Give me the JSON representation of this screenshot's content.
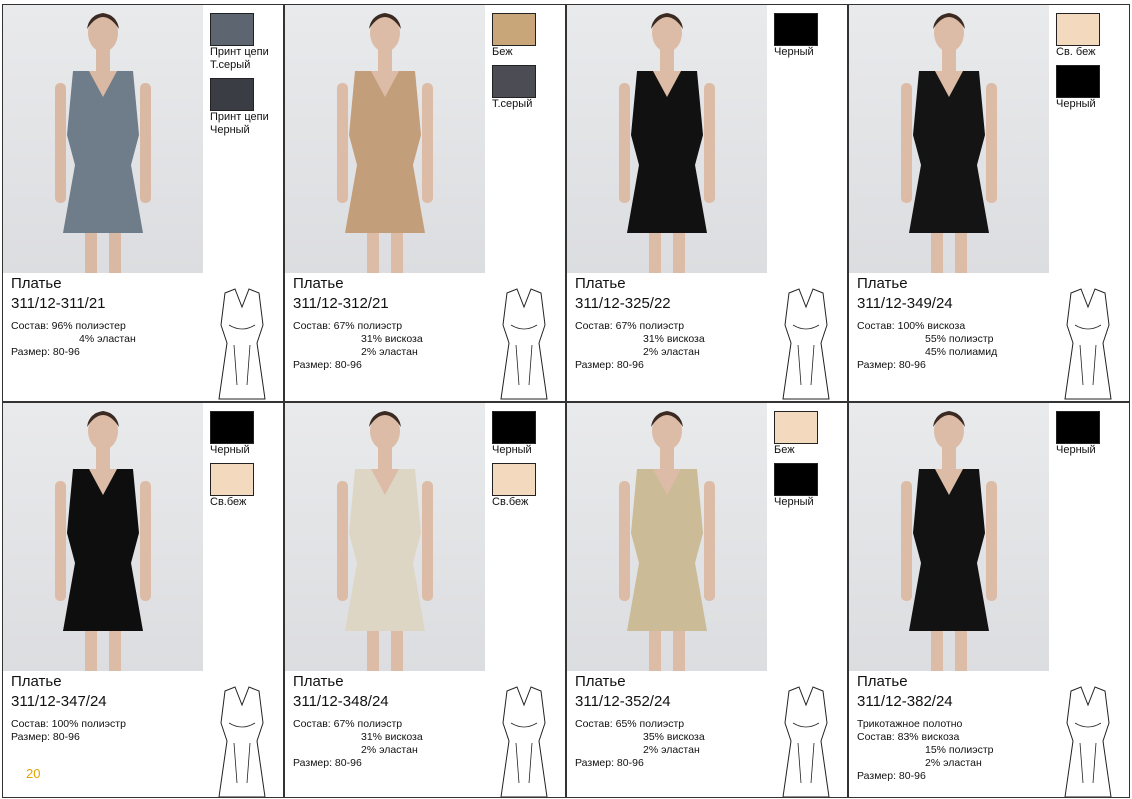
{
  "page_number": "20",
  "cards": [
    {
      "title": "Платье",
      "code": "311/12-311/21",
      "composition": [
        "Состав: 96% полиэстер",
        "4% эластан"
      ],
      "size": "Размер: 80-96",
      "swatches": [
        {
          "label": "Принт цепи\nТ.серый",
          "color": "#5d6670"
        },
        {
          "label": "Принт цепи\nЧерный",
          "color": "#3a3d44"
        }
      ],
      "dress_color": "#6f7c8a",
      "skin": "#d9b8a4"
    },
    {
      "title": "Платье",
      "code": "311/12-312/21",
      "composition": [
        "Состав: 67% полиэстр",
        "31% вискоза",
        "2% эластан"
      ],
      "size": "Размер: 80-96",
      "swatches": [
        {
          "label": "Беж",
          "color": "#c9a57a"
        },
        {
          "label": "Т.серый",
          "color": "#4c4c55"
        }
      ],
      "dress_color": "#c39e7a",
      "skin": "#dcbca6"
    },
    {
      "title": "Платье",
      "code": "311/12-325/22",
      "composition": [
        "Состав: 67% полиэстр",
        "31% вискоза",
        "2% эластан"
      ],
      "size": "Размер: 80-96",
      "swatches": [
        {
          "label": "Черный",
          "color": "#000000"
        }
      ],
      "dress_color": "#111111",
      "skin": "#dcbca6"
    },
    {
      "title": "Платье",
      "code": "311/12-349/24",
      "composition": [
        "Состав: 100% вискоза",
        "55% полиэстр",
        "45% полиамид"
      ],
      "size": "Размер: 80-96",
      "swatches": [
        {
          "label": "Св. беж",
          "color": "#f3d9bd"
        },
        {
          "label": "Черный",
          "color": "#000000"
        }
      ],
      "dress_color": "#141414",
      "skin": "#dcbca6"
    },
    {
      "title": "Платье",
      "code": "311/12-347/24",
      "composition": [
        "Состав: 100% полиэстр"
      ],
      "size": "Размер: 80-96",
      "swatches": [
        {
          "label": "Черный",
          "color": "#000000"
        },
        {
          "label": "Св.беж",
          "color": "#f3d9bd"
        }
      ],
      "dress_color": "#0e0e0e",
      "skin": "#dcbca6"
    },
    {
      "title": "Платье",
      "code": "311/12-348/24",
      "composition": [
        "Состав: 67% полиэстр",
        "31% вискоза",
        "2% эластан"
      ],
      "size": "Размер: 80-96",
      "swatches": [
        {
          "label": "Черный",
          "color": "#000000"
        },
        {
          "label": "Св.беж",
          "color": "#f3d9bd"
        }
      ],
      "dress_color": "#ddd6c4",
      "skin": "#dcbca6"
    },
    {
      "title": "Платье",
      "code": "311/12-352/24",
      "composition": [
        "Состав: 65% полиэстр",
        "35% вискоза",
        "2% эластан"
      ],
      "size": "Размер: 80-96",
      "swatches": [
        {
          "label": "Беж",
          "color": "#f3d9bd"
        },
        {
          "label": "Черный",
          "color": "#000000"
        }
      ],
      "dress_color": "#cbbb97",
      "skin": "#dcbca6"
    },
    {
      "title": "Платье",
      "code": "311/12-382/24",
      "composition": [
        "Трикотажное полотно",
        "Состав: 83% вискоза",
        "15% полиэстр",
        "2% эластан"
      ],
      "size": "Размер: 80-96",
      "swatches": [
        {
          "label": "Черный",
          "color": "#000000"
        }
      ],
      "dress_color": "#121212",
      "skin": "#dcbca6"
    }
  ]
}
